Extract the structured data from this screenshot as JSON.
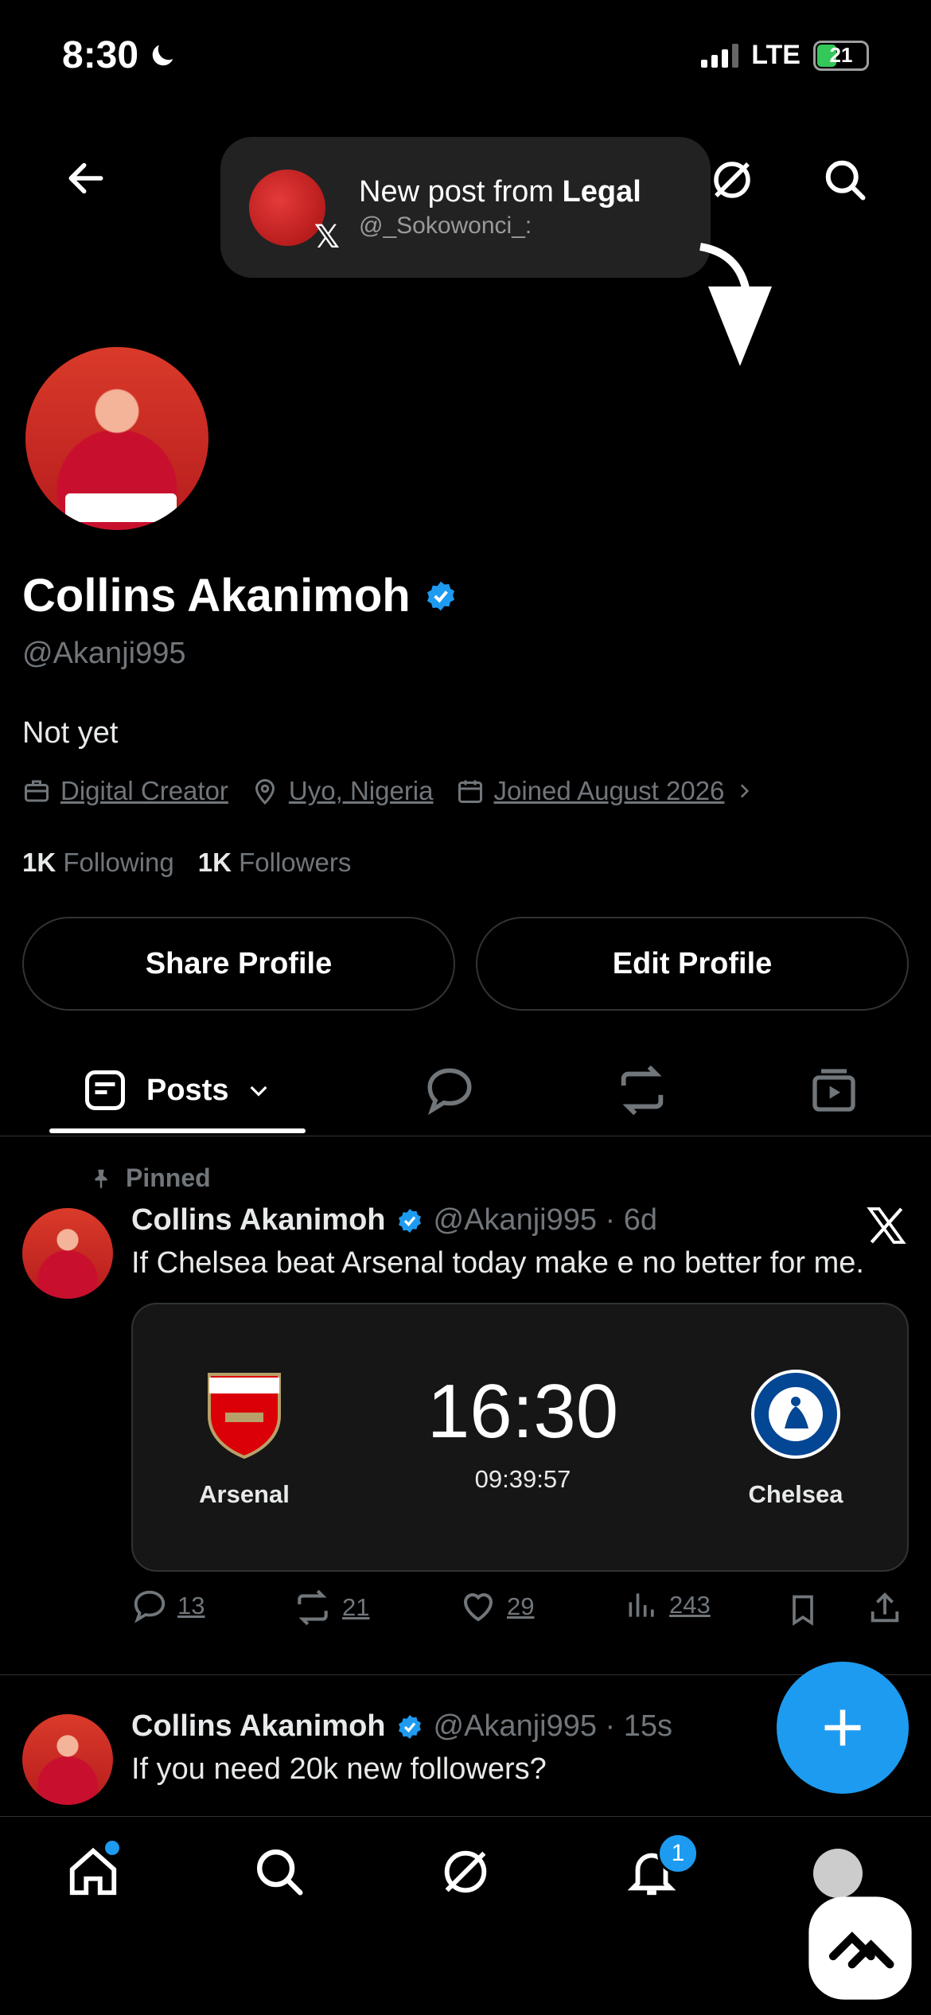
{
  "status_bar": {
    "time": "8:30",
    "network": "LTE",
    "battery": "21"
  },
  "notification": {
    "title_prefix": "New post from ",
    "title_name": "Legal",
    "handle": "@_Sokowonci_:"
  },
  "profile": {
    "name": "Collins Akanimoh",
    "handle": "@Akanji995",
    "bio": "Not yet",
    "category": "Digital Creator",
    "location": "Uyo, Nigeria",
    "joined": "Joined August 2026",
    "following_count": "1K",
    "following_label": "Following",
    "followers_count": "1K",
    "followers_label": "Followers"
  },
  "buttons": {
    "share": "Share Profile",
    "edit": "Edit Profile"
  },
  "tabs": {
    "posts": "Posts"
  },
  "pinned_label": "Pinned",
  "posts": [
    {
      "name": "Collins Akanimoh",
      "handle": "@Akanji995 · 6d",
      "text": "If Chelsea beat Arsenal today make e no better for me.",
      "card": {
        "home": "Arsenal",
        "away": "Chelsea",
        "kickoff": "16:30",
        "countdown": "09:39:57"
      },
      "replies": "13",
      "reposts": "21",
      "likes": "29",
      "views": "243"
    },
    {
      "name": "Collins Akanimoh",
      "handle": "@Akanji995 · 15s",
      "text": "If you need 20k new followers?"
    }
  ],
  "bottom_nav": {
    "notifications_badge": "1"
  },
  "colors": {
    "accent": "#1d9bf0",
    "background": "#000000",
    "muted": "#71767b"
  }
}
